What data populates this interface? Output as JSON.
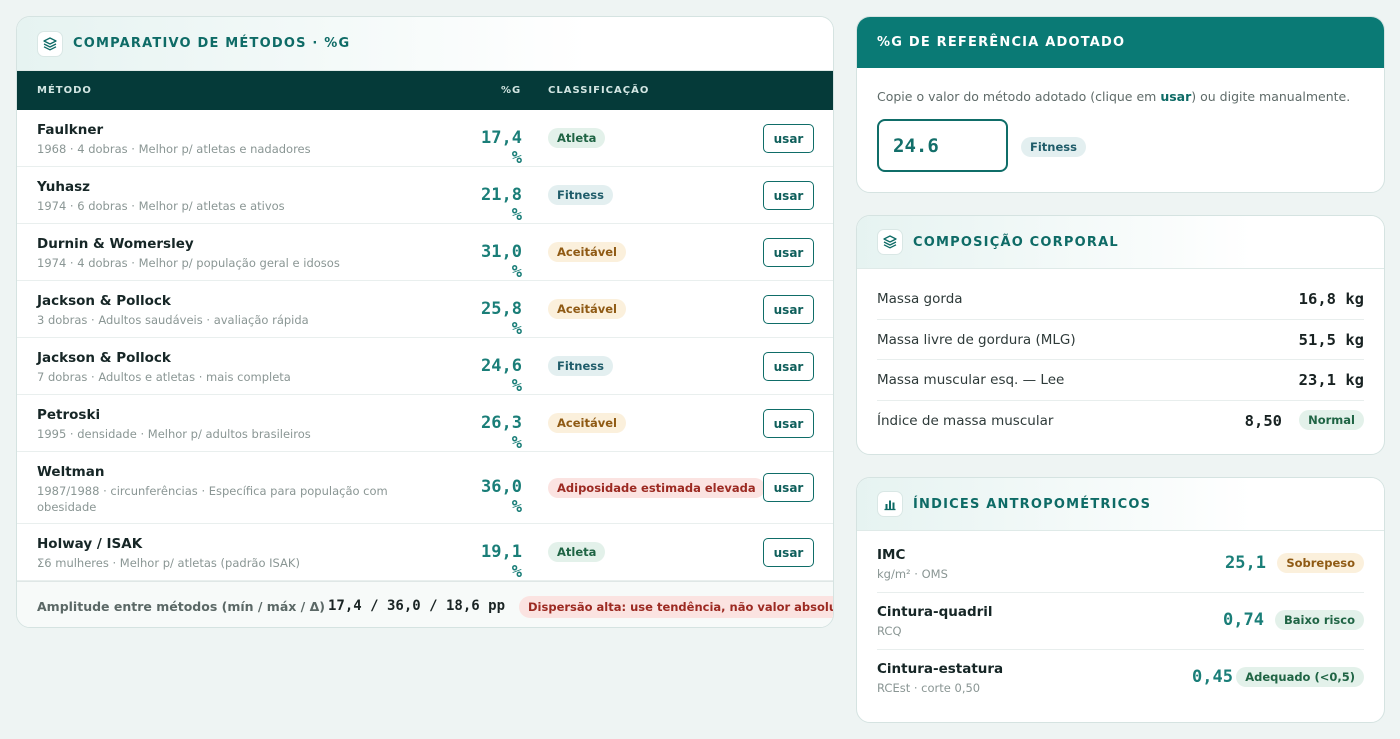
{
  "methods_card": {
    "title": "COMPARATIVO DE MÉTODOS · %G",
    "icon": "layers-icon",
    "columns": {
      "method": "MÉTODO",
      "pct": "%G",
      "classification": "CLASSIFICAÇÃO"
    },
    "rows": [
      {
        "name": "Faulkner",
        "desc": "1968 · 4 dobras · Melhor p/ atletas e nadadores",
        "value": "17,4 %",
        "class": "Atleta",
        "class_style": "green",
        "button": "usar"
      },
      {
        "name": "Yuhasz",
        "desc": "1974 · 6 dobras · Melhor p/ atletas e ativos",
        "value": "21,8 %",
        "class": "Fitness",
        "class_style": "blue",
        "button": "usar"
      },
      {
        "name": "Durnin & Womersley",
        "desc": "1974 · 4 dobras · Melhor p/ população geral e idosos",
        "value": "31,0 %",
        "class": "Aceitável",
        "class_style": "amber",
        "button": "usar"
      },
      {
        "name": "Jackson & Pollock",
        "desc": "3 dobras · Adultos saudáveis · avaliação rápida",
        "value": "25,8 %",
        "class": "Aceitável",
        "class_style": "amber",
        "button": "usar"
      },
      {
        "name": "Jackson & Pollock",
        "desc": "7 dobras · Adultos e atletas · mais completa",
        "value": "24,6 %",
        "class": "Fitness",
        "class_style": "blue",
        "button": "usar"
      },
      {
        "name": "Petroski",
        "desc": "1995 · densidade · Melhor p/ adultos brasileiros",
        "value": "26,3 %",
        "class": "Aceitável",
        "class_style": "amber",
        "button": "usar"
      },
      {
        "name": "Weltman",
        "desc": "1987/1988 · circunferências · Específica para população com obesidade",
        "value": "36,0 %",
        "class": "Adiposidade estimada elevada",
        "class_style": "red",
        "button": "usar",
        "tall": true
      },
      {
        "name": "Holway / ISAK",
        "desc": "Σ6 mulheres · Melhor p/ atletas (padrão ISAK)",
        "value": "19,1 %",
        "class": "Atleta",
        "class_style": "green",
        "button": "usar"
      }
    ],
    "footer": {
      "label": "Amplitude entre métodos (mín / máx / Δ)",
      "value": "17,4 / 36,0 / 18,6 pp",
      "badge": "Dispersão alta: use tendência, não valor absoluto."
    }
  },
  "reference_card": {
    "title": "%G DE REFERÊNCIA ADOTADO",
    "note_prefix": "Copie o valor do método adotado (clique em ",
    "note_bold": "usar",
    "note_suffix": ") ou digite manualmente.",
    "input_value": "24.6",
    "badge": "Fitness"
  },
  "composition_card": {
    "title": "COMPOSIÇÃO CORPORAL",
    "icon": "layers-icon",
    "rows": [
      {
        "label": "Massa gorda",
        "value": "16,8 kg"
      },
      {
        "label": "Massa livre de gordura (MLG)",
        "value": "51,5 kg"
      },
      {
        "label": "Massa muscular esq. — Lee",
        "value": "23,1 kg"
      },
      {
        "label": "Índice de massa muscular",
        "value": "8,50",
        "badge": "Normal"
      }
    ]
  },
  "anthro_card": {
    "title": "ÍNDICES ANTROPOMÉTRICOS",
    "icon": "bar-chart-icon",
    "rows": [
      {
        "name": "IMC",
        "desc": "kg/m² · OMS",
        "value": "25,1",
        "badge": "Sobrepeso",
        "badge_style": "amber"
      },
      {
        "name": "Cintura-quadril",
        "desc": "RCQ",
        "value": "0,74",
        "badge": "Baixo risco",
        "badge_style": "green"
      },
      {
        "name": "Cintura-estatura",
        "desc": "RCEst · corte 0,50",
        "value": "0,45",
        "badge": "Adequado (<0,5)",
        "badge_style": "green"
      }
    ]
  },
  "colors": {
    "accent": "#0a7a75",
    "table_header": "#053a39",
    "value_teal": "#1a7e78",
    "background": "#eef4f3"
  }
}
